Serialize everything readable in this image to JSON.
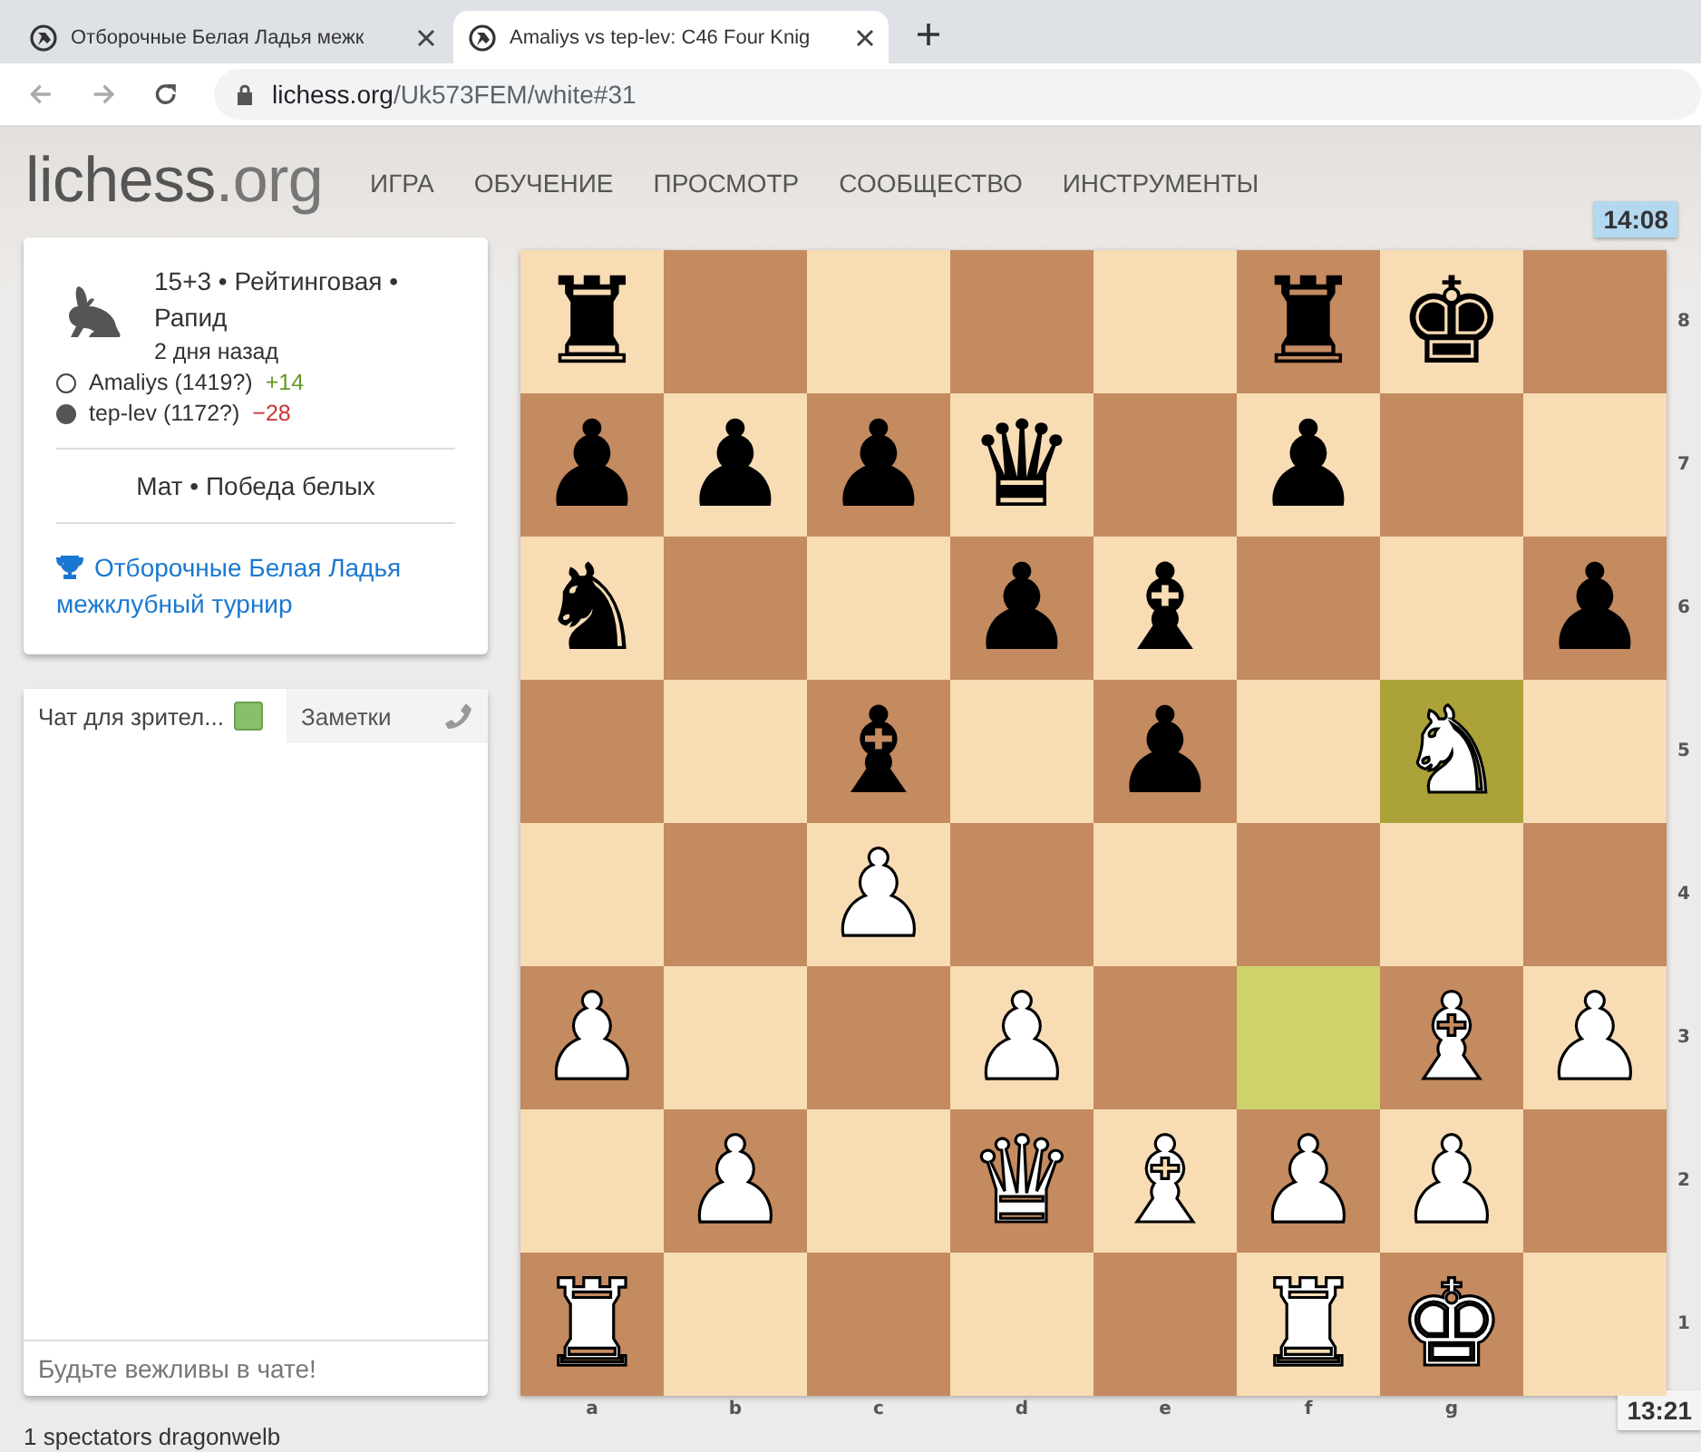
{
  "browser": {
    "tabs": [
      {
        "title": "Отборочные Белая Ладья межк",
        "selected": false
      },
      {
        "title": "Amaliys vs tep-lev: C46 Four Knig",
        "selected": true
      }
    ],
    "address": {
      "host": "lichess.org",
      "path": "/Uk573FEM/white#31"
    }
  },
  "header": {
    "logo": {
      "name": "lichess",
      "suffix": ".org"
    },
    "nav": [
      "ИГРА",
      "ОБУЧЕНИЕ",
      "ПРОСМОТР",
      "СООБЩЕСТВО",
      "ИНСТРУМЕНТЫ"
    ]
  },
  "game_info": {
    "setup": "15+3 • Рейтинговая • Рапид",
    "date": "2 дня назад",
    "players": [
      {
        "black": false,
        "name": "Amaliys (1419?)",
        "rating_change": "+14",
        "color": "#629924"
      },
      {
        "black": true,
        "name": "tep-lev (1172?)",
        "rating_change": "−28",
        "color": "#cc3333"
      }
    ],
    "result": "Мат • Победа белых",
    "tournament": "Отборочные Белая Ладья межклубный турнир"
  },
  "chat": {
    "tabs": [
      {
        "kind": "chat",
        "label": "Чат для зрител...",
        "selected": true,
        "checked": true
      },
      {
        "kind": "notes",
        "label": "Заметки",
        "selected": false
      }
    ],
    "placeholder": "Будьте вежливы в чате!"
  },
  "spectators": "1 spectators dragonwelb",
  "clocks": {
    "top": "14:08",
    "bottom": "13:21"
  },
  "board": {
    "files": [
      "a",
      "b",
      "c",
      "d",
      "e",
      "f",
      "g"
    ],
    "ranks": [
      {
        "label": "8",
        "squares": [
          {
            "piece": "♜",
            "black": true,
            "last_move": false
          },
          {
            "last_move": false
          },
          {
            "last_move": false
          },
          {
            "last_move": false
          },
          {
            "last_move": false
          },
          {
            "piece": "♜",
            "black": true,
            "last_move": false
          },
          {
            "piece": "♚",
            "black": true,
            "last_move": false
          },
          {
            "last_move": false
          }
        ]
      },
      {
        "label": "7",
        "squares": [
          {
            "piece": "♟",
            "black": true,
            "last_move": false
          },
          {
            "piece": "♟",
            "black": true,
            "last_move": false
          },
          {
            "piece": "♟",
            "black": true,
            "last_move": false
          },
          {
            "piece": "♛",
            "black": true,
            "last_move": false
          },
          {
            "last_move": false
          },
          {
            "piece": "♟",
            "black": true,
            "last_move": false
          },
          {
            "last_move": false
          },
          {
            "last_move": false
          }
        ]
      },
      {
        "label": "6",
        "squares": [
          {
            "piece": "♞",
            "black": true,
            "last_move": false
          },
          {
            "last_move": false
          },
          {
            "last_move": false
          },
          {
            "piece": "♟",
            "black": true,
            "last_move": false
          },
          {
            "piece": "♝",
            "black": true,
            "last_move": false
          },
          {
            "last_move": false
          },
          {
            "last_move": false
          },
          {
            "piece": "♟",
            "black": true,
            "last_move": false
          }
        ]
      },
      {
        "label": "5",
        "squares": [
          {
            "last_move": false
          },
          {
            "last_move": false
          },
          {
            "piece": "♝",
            "black": true,
            "last_move": false
          },
          {
            "last_move": false
          },
          {
            "piece": "♟",
            "black": true,
            "last_move": false
          },
          {
            "last_move": false
          },
          {
            "piece": "♞",
            "black": false,
            "last_move": true
          },
          {
            "last_move": false
          }
        ]
      },
      {
        "label": "4",
        "squares": [
          {
            "last_move": false
          },
          {
            "last_move": false
          },
          {
            "piece": "♟",
            "black": false,
            "last_move": false
          },
          {
            "last_move": false
          },
          {
            "last_move": false
          },
          {
            "last_move": false
          },
          {
            "last_move": false
          },
          {
            "last_move": false
          }
        ]
      },
      {
        "label": "3",
        "squares": [
          {
            "piece": "♟",
            "black": false,
            "last_move": false
          },
          {
            "last_move": false
          },
          {
            "last_move": false
          },
          {
            "piece": "♟",
            "black": false,
            "last_move": false
          },
          {
            "last_move": false
          },
          {
            "last_move": true
          },
          {
            "piece": "♝",
            "black": false,
            "last_move": false
          },
          {
            "piece": "♟",
            "black": false,
            "last_move": false
          }
        ]
      },
      {
        "label": "2",
        "squares": [
          {
            "last_move": false
          },
          {
            "piece": "♟",
            "black": false,
            "last_move": false
          },
          {
            "last_move": false
          },
          {
            "piece": "♛",
            "black": false,
            "last_move": false
          },
          {
            "piece": "♝",
            "black": false,
            "last_move": false
          },
          {
            "piece": "♟",
            "black": false,
            "last_move": false
          },
          {
            "piece": "♟",
            "black": false,
            "last_move": false
          },
          {
            "last_move": false
          }
        ]
      },
      {
        "label": "1",
        "squares": [
          {
            "piece": "♜",
            "black": false,
            "last_move": false
          },
          {
            "last_move": false
          },
          {
            "last_move": false
          },
          {
            "last_move": false
          },
          {
            "last_move": false
          },
          {
            "piece": "♜",
            "black": false,
            "last_move": false
          },
          {
            "piece": "♚",
            "black": false,
            "last_move": false
          },
          {
            "last_move": false
          }
        ]
      }
    ]
  }
}
